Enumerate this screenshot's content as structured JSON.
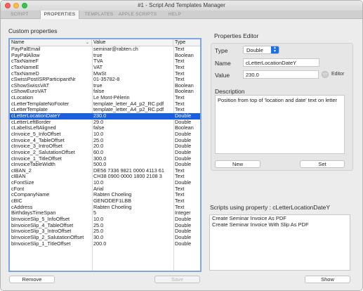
{
  "window": {
    "title": "#1 - Script And Templates Manager"
  },
  "tabs": [
    "SCRIPT",
    "PROPERTIES",
    "TEMPLATES",
    "APPLE SCRIPTS",
    "HELP"
  ],
  "active_tab": "PROPERTIES",
  "custom_properties": {
    "title": "Custom properties",
    "columns": [
      "Name",
      "Value",
      "Type"
    ],
    "rows": [
      [
        "PayPalEmail",
        "seminar@rabten.ch",
        "Text"
      ],
      [
        "PayPalAllow",
        "true",
        "Boolean"
      ],
      [
        "cTaxNameF",
        "TVA",
        "Text"
      ],
      [
        "cTaxNameE",
        "VAT",
        "Text"
      ],
      [
        "cTaxNameD",
        "MwSt",
        "Text"
      ],
      [
        "cSwissPostISRParticipantNr",
        "01-35782-8",
        "Text"
      ],
      [
        "cShowSwissVAT",
        "true",
        "Boolean"
      ],
      [
        "cShowEuroVAT",
        "false",
        "Boolean"
      ],
      [
        "cLocation",
        "Le Mont-Pèlerin",
        "Text"
      ],
      [
        "cLetterTemplateNoFooter",
        "template_letter_A4_p2_RC.pdf",
        "Text"
      ],
      [
        "cLetterTemplate",
        "template_letter_A4_p2_RC.pdf",
        "Text"
      ],
      [
        "cLetterLocationDateY",
        "230.0",
        "Double"
      ],
      [
        "cLetterLeftBorder",
        "29.0",
        "Double"
      ],
      [
        "cLabelIsLeftAligned",
        "false",
        "Boolean"
      ],
      [
        "cInvoice_5_InfoOffset",
        "10.0",
        "Double"
      ],
      [
        "cInvoice_4_TableOffset",
        "25.0",
        "Double"
      ],
      [
        "cInvoice_3_IntroOffset",
        "20.0",
        "Double"
      ],
      [
        "cInvoice_2_SalutationOffset",
        "60.0",
        "Double"
      ],
      [
        "cInvoice_1_TitleOffset",
        "300.0",
        "Double"
      ],
      [
        "cInvoiceTableWidth",
        "500.0",
        "Double"
      ],
      [
        "cIBAN_2",
        "DE56 7336 9821 0000 4113 61",
        "Text"
      ],
      [
        "cIBAN",
        "CH38 0900 0000 1800 2108 3",
        "Text"
      ],
      [
        "cFontSize",
        "10.0",
        "Double"
      ],
      [
        "cFont",
        "Arial",
        "Text"
      ],
      [
        "cCompanyName",
        "Rabten Choeling",
        "Text"
      ],
      [
        "cBIC",
        "GENODEF1LBB",
        "Text"
      ],
      [
        "cAddress",
        "Rabten Choeling",
        "Text"
      ],
      [
        "BirthdaysTimeSpan",
        "5",
        "Integer"
      ],
      [
        "bInvoiceSlip_5_InfoOffset",
        "10.0",
        "Double"
      ],
      [
        "bInvoiceSlip_4_TableOffset",
        "25.0",
        "Double"
      ],
      [
        "bInvoiceSlip_3_IntroOffset",
        "25.0",
        "Double"
      ],
      [
        "bInvoiceSlip_2_SalutationOffset",
        "30.0",
        "Double"
      ],
      [
        "bInvoiceSlip_1_TitleOffset",
        "200.0",
        "Double"
      ]
    ],
    "selected_name": "cLetterLocationDateY",
    "remove_label": "Remove",
    "save_label": "Save"
  },
  "editor": {
    "title": "Properties Editor",
    "type_label": "Type",
    "type_value": "Double",
    "name_label": "Name",
    "name_value": "cLetterLocationDateY",
    "value_label": "Value",
    "value_value": "230.0",
    "editor_label": "Editor",
    "description_label": "Description",
    "description_value": "Position from top of 'location and date' text on letter",
    "new_label": "New",
    "set_label": "Set"
  },
  "scripts": {
    "title": "Scripts using property : cLetterLocationDateY",
    "items": [
      "Create Seminar Invoice As PDF",
      "Create Seminar Invoice With Slip As PDF"
    ],
    "show_label": "Show"
  },
  "colors": {
    "selection": "#1a5fe0",
    "table_border": "#7fa6e0",
    "select_arrows": "#1a6ee8"
  },
  "icons": {
    "sort": "chevron-down-icon",
    "editor": "ellipsis-circle-icon",
    "select": "up-down-arrows-icon"
  }
}
